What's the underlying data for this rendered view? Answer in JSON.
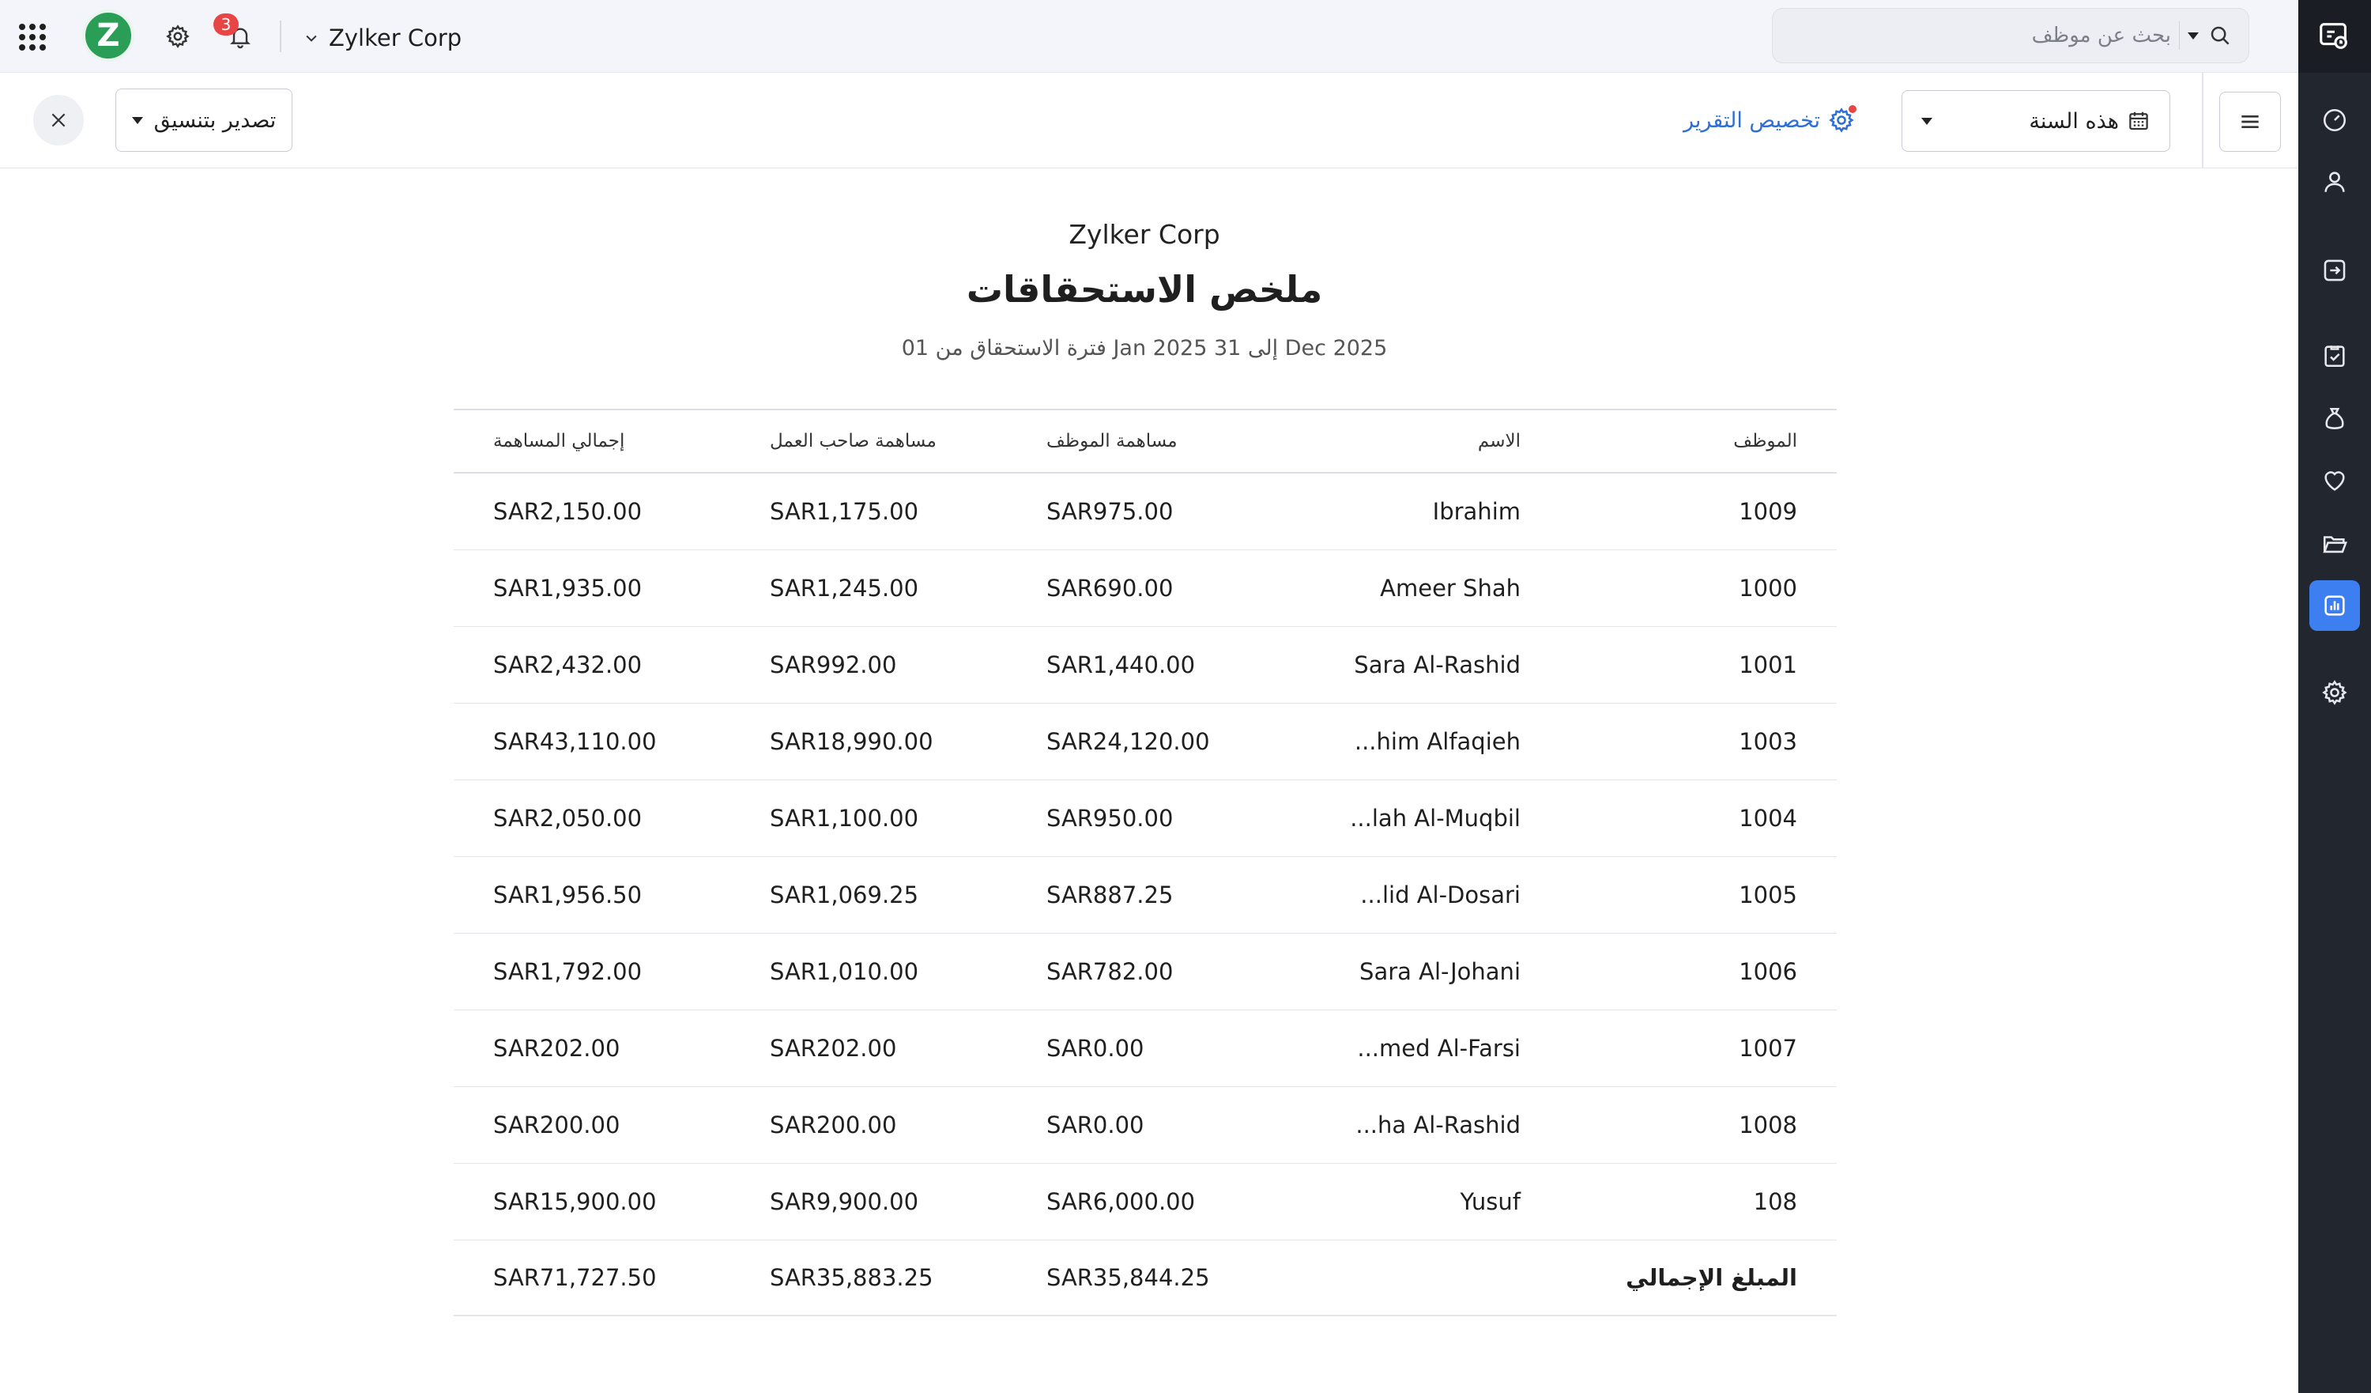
{
  "topbar": {
    "org_name": "Zylker Corp",
    "logo_letter": "Z",
    "notification_count": "3",
    "search_placeholder": "بحث عن موظف"
  },
  "toolbar": {
    "export_label": "تصدير بتنسيق",
    "customize_label": "تخصيص التقرير",
    "period_label": "هذه السنة"
  },
  "report": {
    "org": "Zylker Corp",
    "title": "ملخص الاستحقاقات",
    "subtitle": "فترة الاستحقاق من 01 Jan 2025 إلى 31 Dec 2025",
    "columns": {
      "employee": "الموظف",
      "name": "الاسم",
      "employee_contribution": "مساهمة الموظف",
      "employer_contribution": "مساهمة صاحب العمل",
      "total_contribution": "إجمالي المساهمة"
    },
    "rows": [
      {
        "id": "1009",
        "name": "Ibrahim",
        "employee": "SAR975.00",
        "employer": "SAR1,175.00",
        "total": "SAR2,150.00"
      },
      {
        "id": "1000",
        "name": "Ameer Shah",
        "employee": "SAR690.00",
        "employer": "SAR1,245.00",
        "total": "SAR1,935.00"
      },
      {
        "id": "1001",
        "name": "Sara Al-Rashid",
        "employee": "SAR1,440.00",
        "employer": "SAR992.00",
        "total": "SAR2,432.00"
      },
      {
        "id": "1003",
        "name": "...him Alfaqieh",
        "employee": "SAR24,120.00",
        "employer": "SAR18,990.00",
        "total": "SAR43,110.00"
      },
      {
        "id": "1004",
        "name": "...lah Al-Muqbil",
        "employee": "SAR950.00",
        "employer": "SAR1,100.00",
        "total": "SAR2,050.00"
      },
      {
        "id": "1005",
        "name": "...lid Al-Dosari",
        "employee": "SAR887.25",
        "employer": "SAR1,069.25",
        "total": "SAR1,956.50"
      },
      {
        "id": "1006",
        "name": "Sara Al-Johani",
        "employee": "SAR782.00",
        "employer": "SAR1,010.00",
        "total": "SAR1,792.00"
      },
      {
        "id": "1007",
        "name": "...med Al-Farsi",
        "employee": "SAR0.00",
        "employer": "SAR202.00",
        "total": "SAR202.00"
      },
      {
        "id": "1008",
        "name": "...ha Al-Rashid",
        "employee": "SAR0.00",
        "employer": "SAR200.00",
        "total": "SAR200.00"
      },
      {
        "id": "108",
        "name": "Yusuf",
        "employee": "SAR6,000.00",
        "employer": "SAR9,900.00",
        "total": "SAR15,900.00"
      }
    ],
    "total_row": {
      "label": "المبلغ الإجمالي",
      "employee": "SAR35,844.25",
      "employer": "SAR35,883.25",
      "total": "SAR71,727.50"
    }
  },
  "sidebar": {
    "items": [
      "app-switch-icon",
      "dashboard-icon",
      "employee-icon",
      "pay-runs-icon",
      "approvals-icon",
      "loans-icon",
      "benefits-icon",
      "documents-icon",
      "reports-icon",
      "settings-icon"
    ],
    "active": "reports-icon"
  },
  "colors": {
    "accent": "#3d7ff0",
    "link": "#2d6fd6",
    "logo": "#2a9d56",
    "badge": "#e84646",
    "sidebar": "#22262f"
  }
}
